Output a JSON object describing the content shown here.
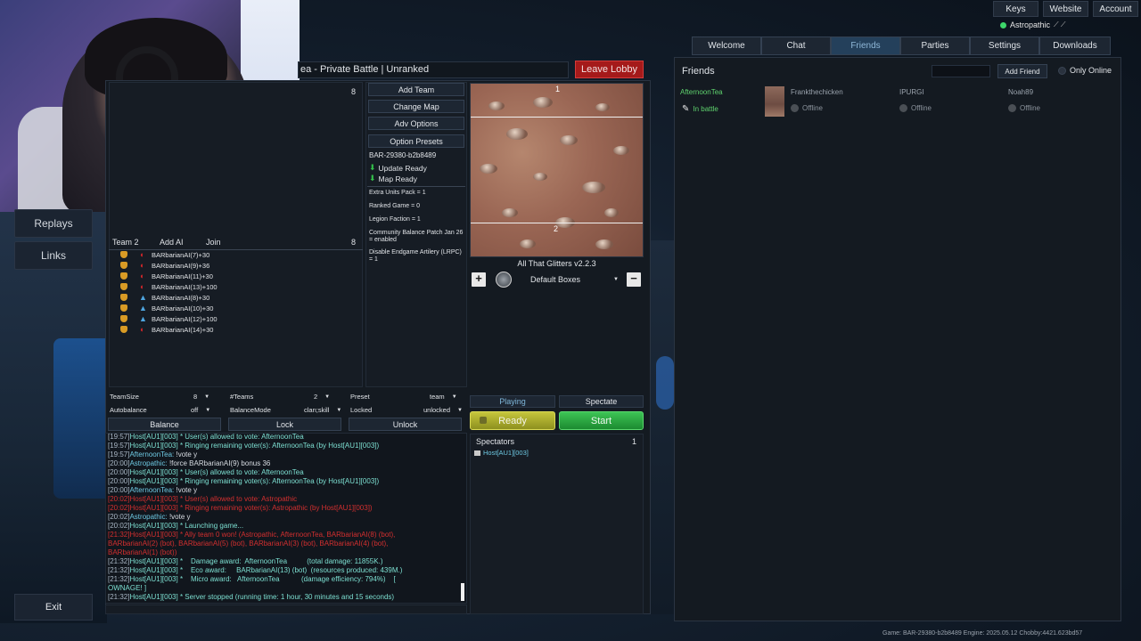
{
  "top_links": [
    "Keys",
    "Website",
    "Account"
  ],
  "user": {
    "name": "Astropathic",
    "icons": "⟋ ⟋"
  },
  "tabs": [
    "Welcome",
    "Chat",
    "Friends",
    "Parties",
    "Settings",
    "Downloads"
  ],
  "active_tab": "Friends",
  "side_nav": {
    "replays": "Replays",
    "links": "Links",
    "exit": "Exit"
  },
  "friends": {
    "title": "Friends",
    "add_friend": "Add Friend",
    "only_online": "Only Online",
    "list": [
      {
        "name": "AfternoonTea",
        "status": "In battle"
      },
      {
        "name": "Frankthechicken",
        "status": "Offline"
      },
      {
        "name": "IPURGI",
        "status": "Offline"
      },
      {
        "name": "Noah89",
        "status": "Offline"
      }
    ]
  },
  "lobby": {
    "title": "ea - Private Battle | Unranked",
    "leave": "Leave Lobby",
    "team1_count": "8",
    "team2": {
      "label": "Team 2",
      "add_ai": "Add AI",
      "join": "Join",
      "count": "8"
    },
    "ai_players": [
      {
        "name": "BARbarianAI(7)+30",
        "faction": "C"
      },
      {
        "name": "BARbarianAI(9)+36",
        "faction": "C"
      },
      {
        "name": "BARbarianAI(11)+30",
        "faction": "C"
      },
      {
        "name": "BARbarianAI(13)+100",
        "faction": "C"
      },
      {
        "name": "BARbarianAI(8)+30",
        "faction": "A"
      },
      {
        "name": "BARbarianAI(10)+30",
        "faction": "A"
      },
      {
        "name": "BARbarianAI(12)+100",
        "faction": "A"
      },
      {
        "name": "BARbarianAI(14)+30",
        "faction": "C"
      }
    ],
    "buttons": {
      "add_team": "Add Team",
      "change_map": "Change Map",
      "adv_options": "Adv Options",
      "option_presets": "Option Presets"
    },
    "version": "BAR-29380-b2b8489",
    "update_ready": "Update Ready",
    "map_ready": "Map Ready",
    "options": [
      "Extra Units Pack = 1",
      "Ranked Game = 0",
      "Legion Faction = 1",
      "Community Balance Patch Jan 26 = enabled",
      "Disable Endgame Artilery (LRPC) = 1"
    ],
    "map": {
      "name": "All That Glitters v2.2.3",
      "start_1": "1",
      "start_2": "2",
      "boxes": "Default Boxes"
    },
    "settings": {
      "teamsize_label": "TeamSize",
      "teamsize": "8",
      "teams_label": "#Teams",
      "teams": "2",
      "preset_label": "Preset",
      "preset": "team",
      "autobalance_label": "Autobalance",
      "autobalance": "off",
      "balancemode_label": "BalanceMode",
      "balancemode": "clan;skill",
      "locked_label": "Locked",
      "locked": "unlocked"
    },
    "actions": {
      "balance": "Balance",
      "lock": "Lock",
      "unlock": "Unlock"
    },
    "playing": "Playing",
    "spectate": "Spectate",
    "ready": "Ready",
    "start": "Start",
    "spectators": {
      "title": "Spectators",
      "count": "1",
      "list": [
        "Host[AU1][003]"
      ]
    }
  },
  "chat": [
    {
      "time": "[19:57]",
      "who": "Host[AU1][003]",
      "text": " * User(s) allowed to vote: AfternoonTea",
      "cls": "host"
    },
    {
      "time": "[19:57]",
      "who": "Host[AU1][003]",
      "text": " * Ringing remaining voter(s): AfternoonTea (by Host[AU1][003])",
      "cls": "host"
    },
    {
      "time": "[19:57]",
      "who": "AfternoonTea:",
      "text": " !vote y",
      "cls": "tea"
    },
    {
      "time": "[20:00]",
      "who": "Astropathic:",
      "text": " !force BARbarianAI(9) bonus 36",
      "cls": "astro"
    },
    {
      "time": "[20:00]",
      "who": "Host[AU1][003]",
      "text": " * User(s) allowed to vote: AfternoonTea",
      "cls": "host"
    },
    {
      "time": "[20:00]",
      "who": "Host[AU1][003]",
      "text": " * Ringing remaining voter(s): AfternoonTea (by Host[AU1][003])",
      "cls": "host"
    },
    {
      "time": "[20:00]",
      "who": "AfternoonTea:",
      "text": " !vote y",
      "cls": "tea"
    },
    {
      "time": "[20:02]",
      "who": "Host[AU1][003]",
      "text": " * User(s) allowed to vote: Astropathic",
      "cls": "red"
    },
    {
      "time": "[20:02]",
      "who": "Host[AU1][003]",
      "text": " * Ringing remaining voter(s): Astropathic (by Host[AU1][003])",
      "cls": "red"
    },
    {
      "time": "[20:02]",
      "who": "Astropathic:",
      "text": " !vote y",
      "cls": "astro"
    },
    {
      "time": "[20:02]",
      "who": "Host[AU1][003]",
      "text": " * Launching game...",
      "cls": "host"
    },
    {
      "time": "[21:32]",
      "who": "Host[AU1][003]",
      "text": " * Ally team 0 won! (Astropathic, AfternoonTea, BARbarianAI(8) (bot),",
      "cls": "red"
    },
    {
      "time": "",
      "who": "",
      "text": "BARbarianAI(2) (bot), BARbarianAI(5) (bot), BARbarianAI(3) (bot), BARbarianAI(4) (bot),",
      "cls": "red"
    },
    {
      "time": "",
      "who": "",
      "text": "BARbarianAI(1) (bot))",
      "cls": "red"
    },
    {
      "time": "[21:32]",
      "who": "Host[AU1][003]",
      "text": " *    Damage award:  AfternoonTea          (total damage: 11855K.)",
      "cls": "host"
    },
    {
      "time": "[21:32]",
      "who": "Host[AU1][003]",
      "text": " *    Eco award:     BARbarianAI(13) (bot)  (resources produced: 439M.)",
      "cls": "host"
    },
    {
      "time": "[21:32]",
      "who": "Host[AU1][003]",
      "text": " *    Micro award:   AfternoonTea           (damage efficiency: 794%)    [",
      "cls": "host"
    },
    {
      "time": "",
      "who": "",
      "text": "OWNAGE! ]",
      "cls": "host"
    },
    {
      "time": "[21:32]",
      "who": "Host[AU1][003]",
      "text": " * Server stopped (running time: 1 hour, 30 minutes and 15 seconds)",
      "cls": "host"
    }
  ],
  "footer": "Game: BAR-29380-b2b8489  Engine: 2025.05.12  Chobby:4421.623bd57"
}
